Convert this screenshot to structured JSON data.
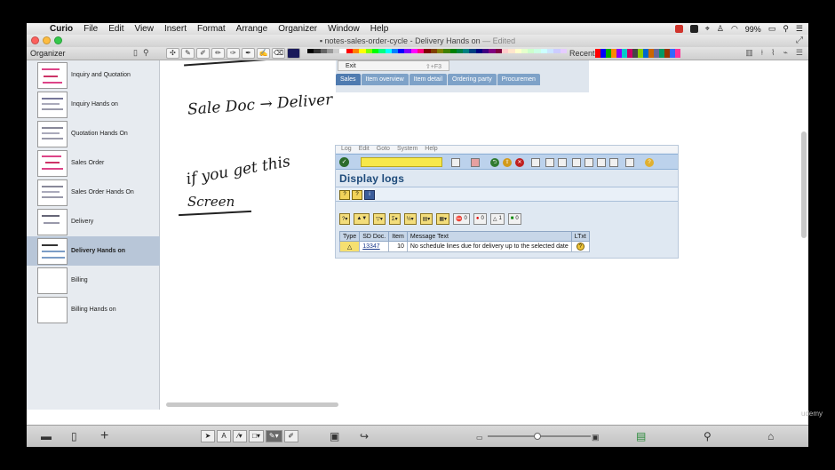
{
  "menubar": {
    "app": "Curio",
    "items": [
      "File",
      "Edit",
      "View",
      "Insert",
      "Format",
      "Arrange",
      "Organizer",
      "Window",
      "Help"
    ],
    "battery": "99%"
  },
  "window": {
    "title": "notes-sales-order-cycle - Delivery Hands on",
    "edited": "— Edited"
  },
  "toolbar": {
    "organizer_label": "Organizer",
    "recent_label": "Recent",
    "palette": [
      "#000000",
      "#333333",
      "#666666",
      "#999999",
      "#cccccc",
      "#ffffff",
      "#ff0000",
      "#ff8000",
      "#ffff00",
      "#80ff00",
      "#00ff00",
      "#00ff80",
      "#00ffff",
      "#0080ff",
      "#0000ff",
      "#8000ff",
      "#ff00ff",
      "#ff0080",
      "#800000",
      "#804000",
      "#808000",
      "#408000",
      "#008000",
      "#008040",
      "#008080",
      "#004080",
      "#000080",
      "#400080",
      "#800080",
      "#800040",
      "#ffcccc",
      "#ffe5cc",
      "#ffffcc",
      "#e5ffcc",
      "#ccffcc",
      "#ccffe5",
      "#ccffff",
      "#cce5ff",
      "#ccccff",
      "#e5ccff"
    ],
    "recent_colors": [
      "#ff0000",
      "#0000ff",
      "#00aa00",
      "#ff8800",
      "#8800ff",
      "#00cccc",
      "#cc0066",
      "#444444",
      "#88cc00",
      "#0066cc",
      "#cc6600",
      "#666699",
      "#009966",
      "#993300",
      "#3366ff",
      "#ff3399"
    ]
  },
  "sidebar": {
    "items": [
      {
        "label": "Inquiry and Quotation"
      },
      {
        "label": "Inquiry Hands on"
      },
      {
        "label": "Quotation Hands On"
      },
      {
        "label": "Sales Order"
      },
      {
        "label": "Sales Order Hands On"
      },
      {
        "label": "Delivery"
      },
      {
        "label": "Delivery Hands on"
      },
      {
        "label": "Billing"
      },
      {
        "label": "Billing Hands on"
      }
    ]
  },
  "canvas": {
    "handwriting": {
      "line1": "Sale Doc → Deliver",
      "line2a": "if you get this",
      "line2b": "Screen"
    },
    "sap_top": {
      "menu_item": "Exit",
      "menu_shortcut": "⇧+F3",
      "tabs": [
        "Sales",
        "Item overview",
        "Item detail",
        "Ordering party",
        "Procuremen"
      ]
    },
    "sap_log": {
      "menu": [
        "Log",
        "Edit",
        "Goto",
        "System",
        "Help"
      ],
      "title": "Display logs",
      "alv_counts": {
        "errors": "0",
        "stop": "0",
        "warnings": "1",
        "ok": "0"
      },
      "columns": [
        "Type",
        "SD Doc.",
        "Item",
        "Message Text",
        "LTxt"
      ],
      "rows": [
        {
          "type": "△",
          "sd_doc": "13347",
          "item": "10",
          "message": "No schedule lines due for delivery up to the selected date",
          "ltxt": "?"
        }
      ]
    }
  },
  "watermark": "udemy"
}
